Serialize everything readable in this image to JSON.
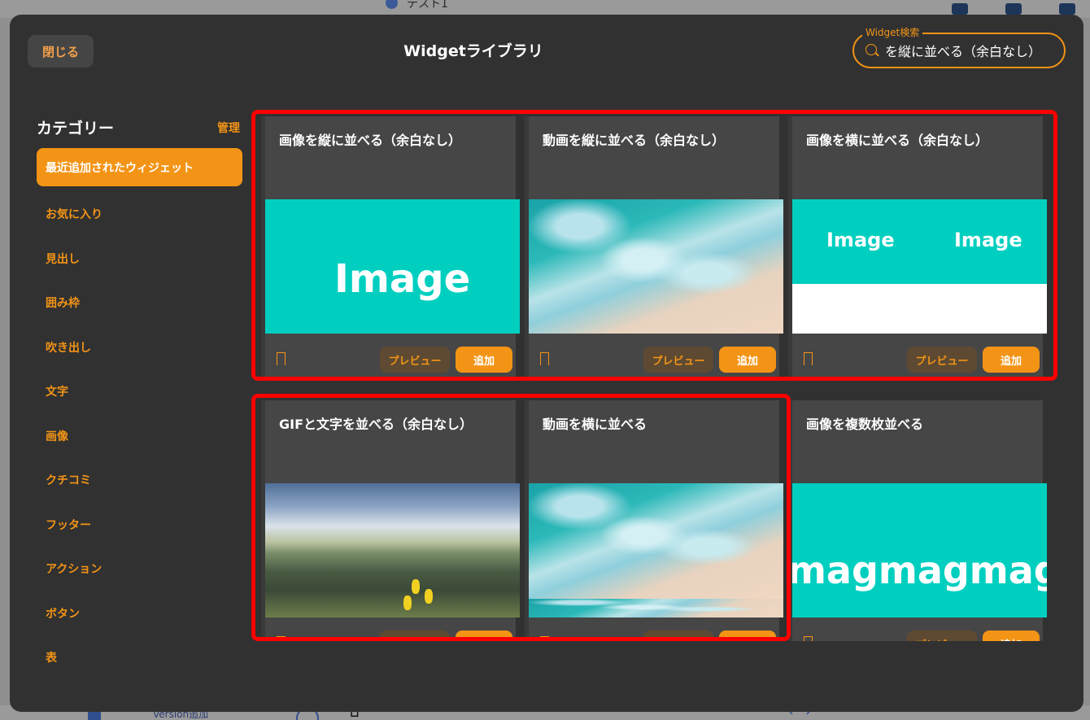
{
  "background": {
    "tab_text": "テスト1",
    "bottom_label": "Version追加"
  },
  "modal": {
    "close_label": "閉じる",
    "title": "Widgetライブラリ",
    "search": {
      "legend": "Widget検索",
      "value": "を縦に並べる（余白なし）"
    }
  },
  "sidebar": {
    "title": "カテゴリー",
    "manage_label": "管理",
    "items": [
      {
        "label": "最近追加されたウィジェット",
        "active": true
      },
      {
        "label": "お気に入り"
      },
      {
        "label": "見出し"
      },
      {
        "label": "囲み枠"
      },
      {
        "label": "吹き出し"
      },
      {
        "label": "文字"
      },
      {
        "label": "画像"
      },
      {
        "label": "クチコミ"
      },
      {
        "label": "フッター"
      },
      {
        "label": "アクション"
      },
      {
        "label": "ボタン"
      },
      {
        "label": "表"
      }
    ]
  },
  "widgets": [
    {
      "title": "画像を縦に並べる（余白なし）",
      "thumb": "teal-image",
      "thumb_text": "Image"
    },
    {
      "title": "動画を縦に並べる（余白なし）",
      "thumb": "sea"
    },
    {
      "title": "画像を横に並べる（余白なし）",
      "thumb": "teal-two-images",
      "thumb_text_1": "Image",
      "thumb_text_2": "Image"
    },
    {
      "title": "GIFと文字を並べる（余白なし）",
      "thumb": "mountain"
    },
    {
      "title": "動画を横に並べる",
      "thumb": "sea"
    },
    {
      "title": "画像を複数枚並べる",
      "thumb": "teal-multi",
      "thumb_text": "magmagmage"
    }
  ],
  "buttons": {
    "preview_label": "プレビュー",
    "add_label": "追加"
  },
  "colors": {
    "accent": "#f39416",
    "modal_bg": "#313131",
    "card_bg": "#464646",
    "thumb_teal": "#00cfc0",
    "highlight": "#ff0000"
  }
}
